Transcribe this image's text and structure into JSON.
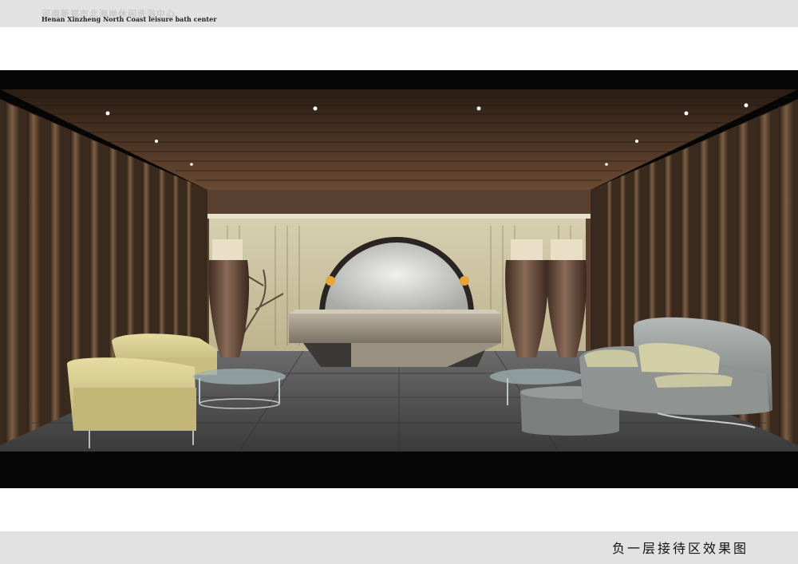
{
  "header": {
    "title_cn": "河南新郑市北海岸休闲洗浴中心",
    "title_en": "Henan Xinzheng North Coast leisure bath center"
  },
  "caption": {
    "text": "负一层接待区效果图"
  },
  "colors": {
    "band": "#e2e2e2",
    "wood_dark": "#3a2a1e",
    "wood_light": "#8a6a4c",
    "mural": "#cfc7a8",
    "floor": "#4a4a4a",
    "armchair": "#d7cc8e",
    "sofa": "#8d9090"
  }
}
